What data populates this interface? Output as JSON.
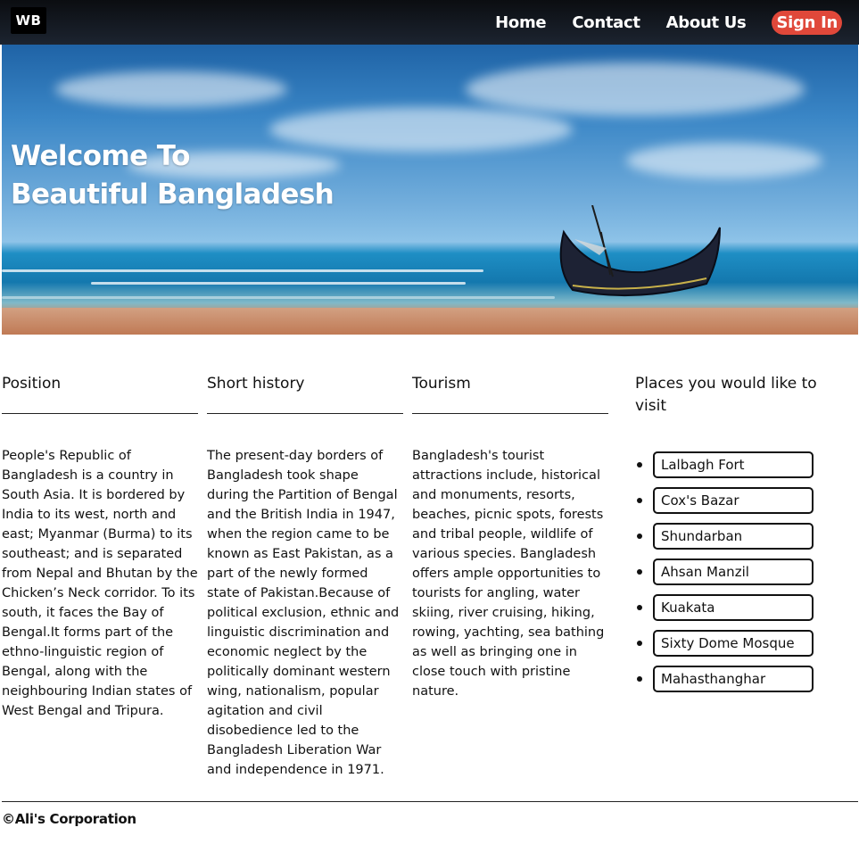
{
  "navbar": {
    "logo": "WB",
    "links": [
      "Home",
      "Contact",
      "About Us"
    ],
    "signin": "Sign In"
  },
  "hero": {
    "title_line1": "Welcome To",
    "title_line2": "Beautiful Bangladesh"
  },
  "sections": [
    {
      "heading": "Position",
      "text": "People's Republic of Bangladesh is a country in South Asia. It is bordered by India to its west, north and east; Myanmar (Burma) to its southeast; and is separated from Nepal and Bhutan by the Chicken’s Neck corridor. To its south, it faces the Bay of Bengal.It forms part of the ethno-linguistic region of Bengal, along with the neighbouring Indian states of West Bengal and Tripura."
    },
    {
      "heading": "Short history",
      "text": "The present-day borders of Bangladesh took shape during the Partition of Bengal and the British India in 1947, when the region came to be known as East Pakistan, as a part of the newly formed state of Pakistan.Because of political exclusion, ethnic and linguistic discrimination and economic neglect by the politically dominant western wing, nationalism, popular agitation and civil disobedience led to the Bangladesh Liberation War and independence in 1971."
    },
    {
      "heading": "Tourism",
      "text": "Bangladesh's tourist attractions include, historical and monuments, resorts, beaches, picnic spots, forests and tribal people, wildlife of various species. Bangladesh offers ample opportunities to tourists for angling, water skiing, river cruising, hiking, rowing, yachting, sea bathing as well as bringing one in close touch with pristine nature."
    }
  ],
  "places": {
    "heading": "Places you would like to visit",
    "items": [
      "Lalbagh Fort",
      "Cox's Bazar",
      "Shundarban",
      "Ahsan Manzil",
      "Kuakata",
      "Sixty Dome Mosque",
      "Mahasthanghar"
    ]
  },
  "footer": {
    "text": "©Ali's Corporation"
  },
  "colors": {
    "navbar_bg": "#12161d",
    "signin_bg": "#e0483a",
    "text": "#111111"
  }
}
